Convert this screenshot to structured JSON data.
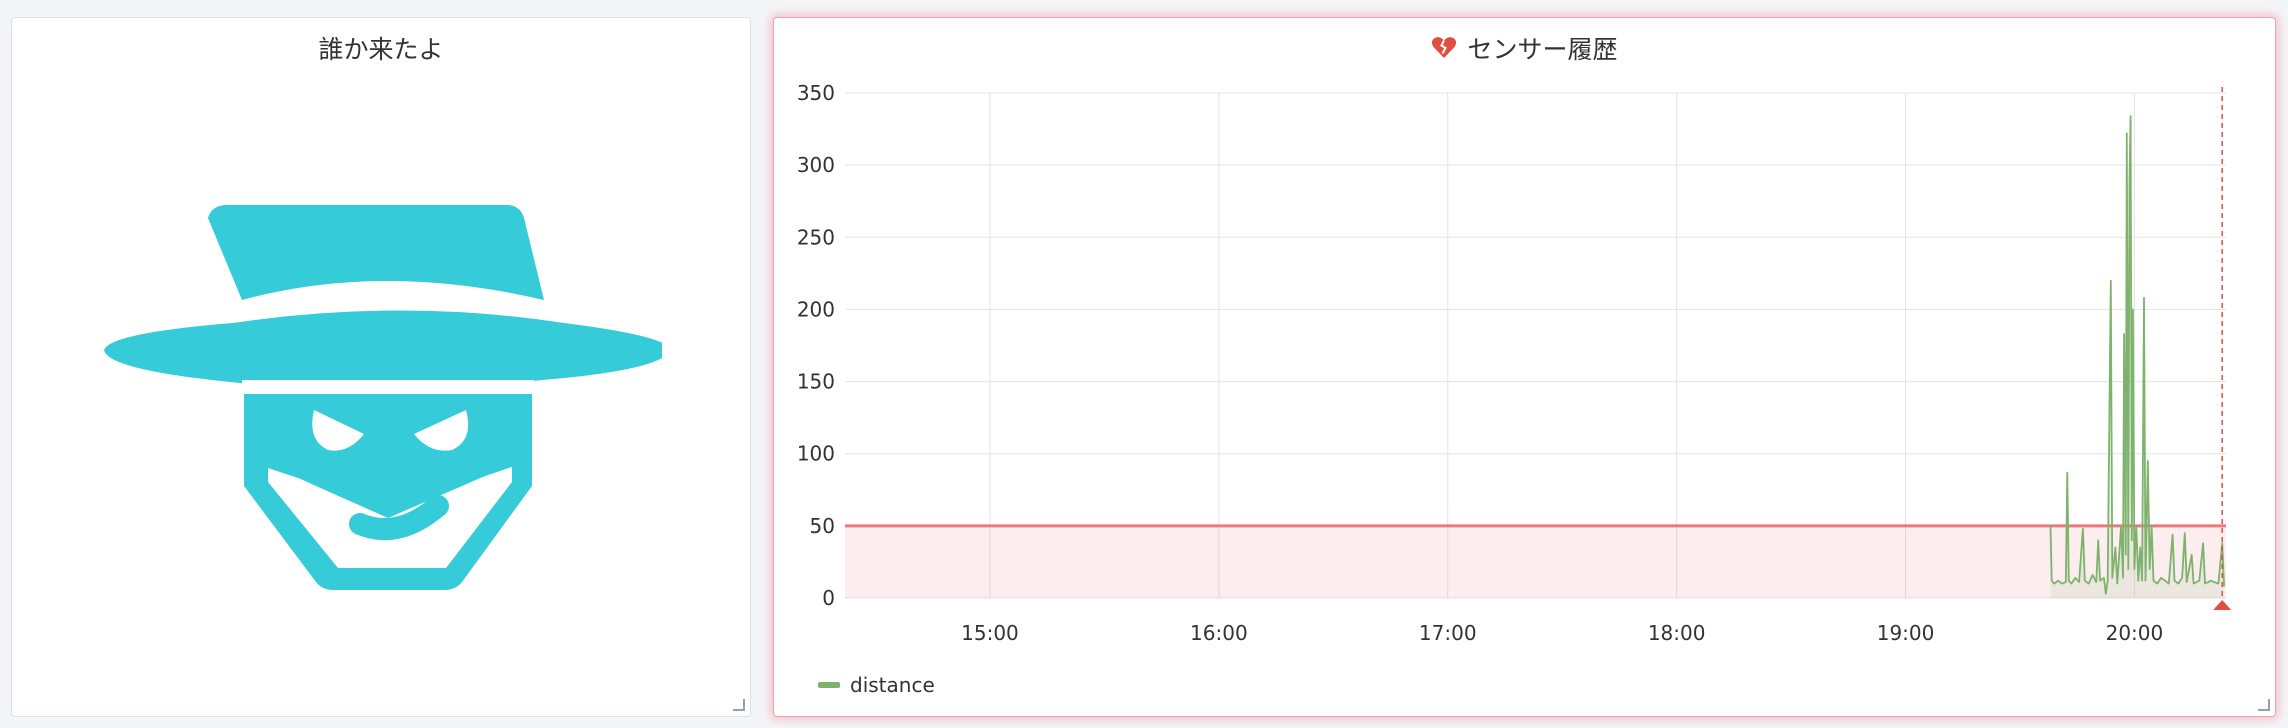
{
  "left_panel": {
    "title": "誰か来たよ",
    "icon": "masked-burglar-icon",
    "icon_color": "#36cbd8"
  },
  "right_panel": {
    "title": "センサー履歴",
    "title_icon": "broken-heart-icon",
    "alert_color": "#e24d42",
    "legend": [
      {
        "label": "distance",
        "color": "#7eb26d"
      }
    ]
  },
  "chart_data": {
    "type": "line",
    "title": "センサー履歴",
    "xlabel": "",
    "ylabel": "",
    "ylim": [
      0,
      350
    ],
    "yticks": [
      0,
      50,
      100,
      150,
      200,
      250,
      300,
      350
    ],
    "x_range_minutes": [
      862,
      1224
    ],
    "xticks": [
      {
        "minute": 900,
        "label": "15:00"
      },
      {
        "minute": 960,
        "label": "16:00"
      },
      {
        "minute": 1020,
        "label": "17:00"
      },
      {
        "minute": 1080,
        "label": "18:00"
      },
      {
        "minute": 1140,
        "label": "19:00"
      },
      {
        "minute": 1200,
        "label": "20:00"
      }
    ],
    "threshold": 50,
    "now_minute": 1223,
    "grid": true,
    "legend_position": "bottom-left",
    "series": [
      {
        "name": "distance",
        "color": "#7eb26d",
        "points": [
          [
            1178,
            50
          ],
          [
            1178.3,
            12
          ],
          [
            1179,
            10
          ],
          [
            1180,
            12
          ],
          [
            1181,
            10
          ],
          [
            1182,
            11
          ],
          [
            1182.4,
            87
          ],
          [
            1182.8,
            12
          ],
          [
            1183.5,
            10
          ],
          [
            1184.5,
            14
          ],
          [
            1185.5,
            11
          ],
          [
            1186.5,
            48
          ],
          [
            1187,
            12
          ],
          [
            1188,
            10
          ],
          [
            1189,
            16
          ],
          [
            1190,
            11
          ],
          [
            1190.5,
            40
          ],
          [
            1191,
            12
          ],
          [
            1192,
            14
          ],
          [
            1192.5,
            3
          ],
          [
            1193,
            12
          ],
          [
            1193.8,
            220
          ],
          [
            1194.2,
            14
          ],
          [
            1195,
            35
          ],
          [
            1195.5,
            10
          ],
          [
            1196.5,
            50
          ],
          [
            1197,
            14
          ],
          [
            1197.3,
            183
          ],
          [
            1197.7,
            30
          ],
          [
            1198,
            322
          ],
          [
            1198.4,
            20
          ],
          [
            1198.7,
            290
          ],
          [
            1199,
            334
          ],
          [
            1199.3,
            40
          ],
          [
            1199.6,
            200
          ],
          [
            1200,
            20
          ],
          [
            1200.5,
            50
          ],
          [
            1201,
            12
          ],
          [
            1201.5,
            35
          ],
          [
            1202,
            12
          ],
          [
            1202.5,
            208
          ],
          [
            1202.9,
            12
          ],
          [
            1203.5,
            95
          ],
          [
            1204,
            20
          ],
          [
            1204.5,
            50
          ],
          [
            1205,
            12
          ],
          [
            1206,
            10
          ],
          [
            1207,
            14
          ],
          [
            1208,
            12
          ],
          [
            1209,
            10
          ],
          [
            1210,
            44
          ],
          [
            1210.5,
            12
          ],
          [
            1211.5,
            10
          ],
          [
            1212.5,
            14
          ],
          [
            1213.2,
            45
          ],
          [
            1213.7,
            11
          ],
          [
            1215,
            30
          ],
          [
            1215.5,
            10
          ],
          [
            1217,
            12
          ],
          [
            1218,
            38
          ],
          [
            1218.5,
            10
          ],
          [
            1220,
            12
          ],
          [
            1222,
            10
          ],
          [
            1223,
            38
          ],
          [
            1223.5,
            8
          ]
        ]
      }
    ]
  }
}
